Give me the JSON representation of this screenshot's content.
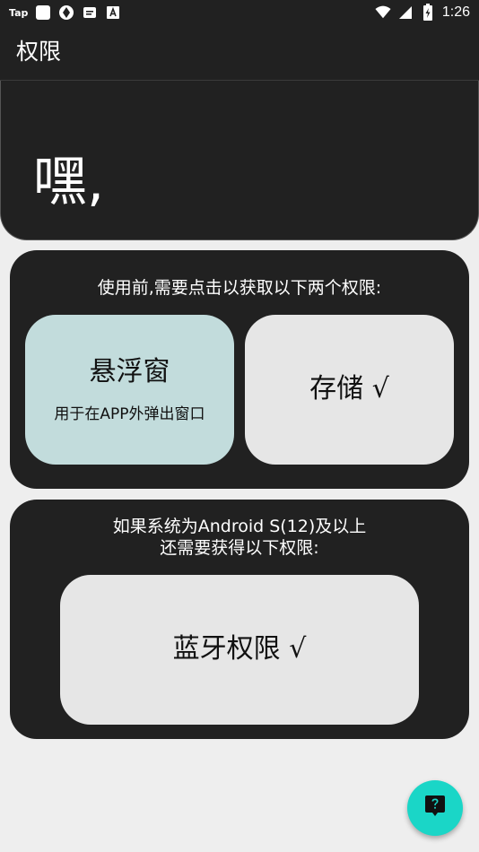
{
  "status_bar": {
    "app_badge": "Tap",
    "time": "1:26"
  },
  "app_bar": {
    "title": "权限"
  },
  "header": {
    "greeting": "嘿,"
  },
  "panel_basic": {
    "caption": "使用前,需要点击以获取以下两个权限:",
    "overlay": {
      "title": "悬浮窗",
      "subtitle": "用于在APP外弹出窗口"
    },
    "storage": {
      "title": "存储 √"
    }
  },
  "panel_android12": {
    "caption_line1": "如果系统为Android S(12)及以上",
    "caption_line2": "还需要获得以下权限:",
    "bluetooth": {
      "title": "蓝牙权限 √"
    }
  },
  "fab": {
    "icon": "help-icon"
  },
  "colors": {
    "dark_surface": "#212121",
    "background": "#eeeeee",
    "overlay_button": "#c2dcdc",
    "granted_button": "#e6e6e6",
    "fab": "#1ad6c7"
  }
}
